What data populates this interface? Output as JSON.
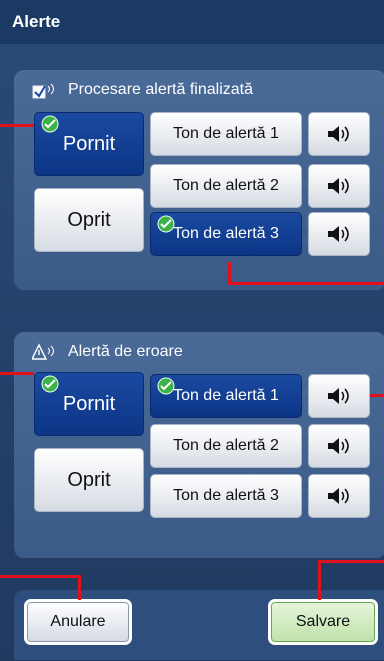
{
  "window": {
    "title": "Alerte"
  },
  "section_completed": {
    "title": "Procesare alertă finalizată",
    "on_label": "Pornit",
    "off_label": "Oprit",
    "tones": [
      "Ton de alertă 1",
      "Ton de alertă 2",
      "Ton de alertă 3"
    ]
  },
  "section_error": {
    "title": "Alertă de eroare",
    "on_label": "Pornit",
    "off_label": "Oprit",
    "tones": [
      "Ton de alertă 1",
      "Ton de alertă 2",
      "Ton de alertă 3"
    ]
  },
  "footer": {
    "cancel_label": "Anulare",
    "save_label": "Salvare"
  },
  "colors": {
    "callout": "#e0111a",
    "selected": "#0c3586",
    "save": "#bfe2a8"
  }
}
